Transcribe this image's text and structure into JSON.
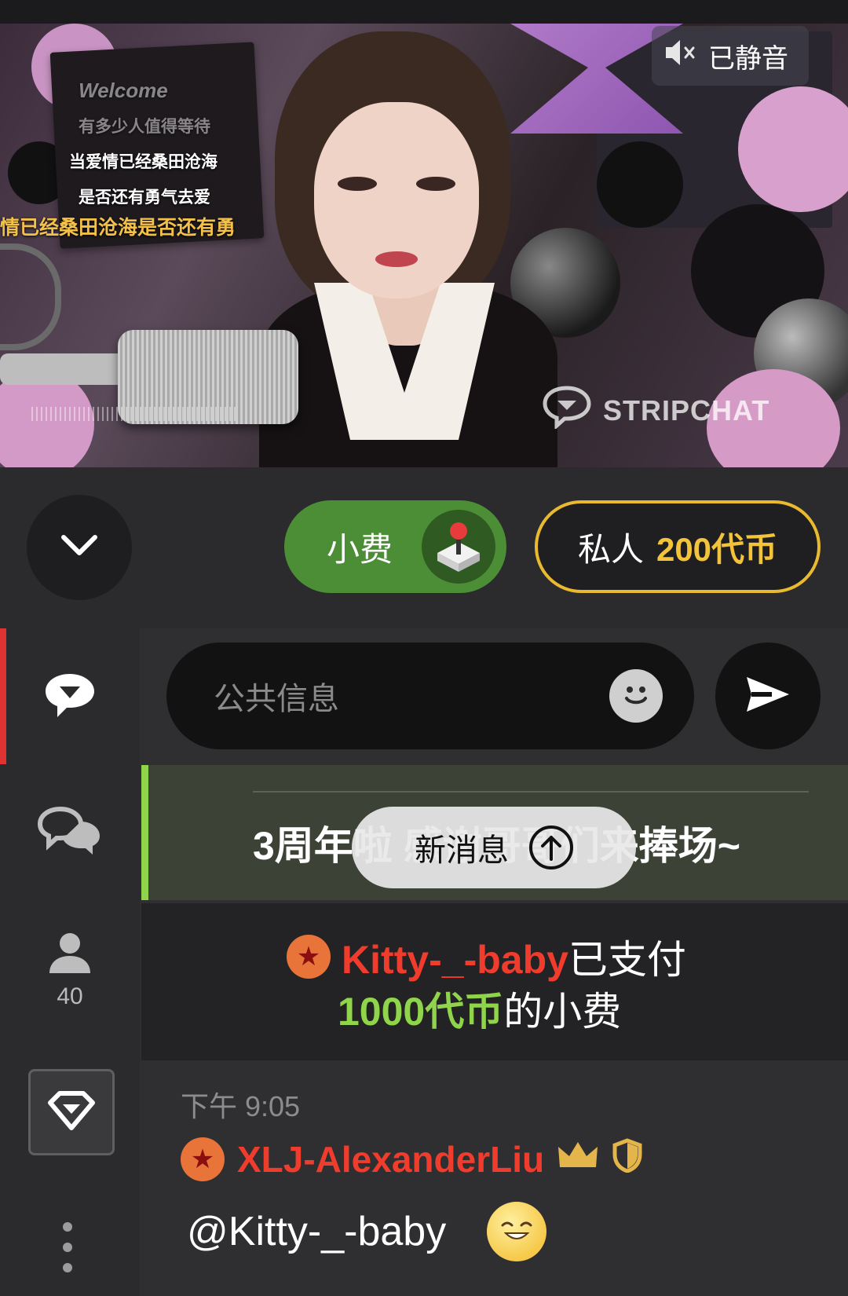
{
  "video": {
    "muted_label": "已静音",
    "watermark": "STRIPCHAT",
    "poster_lines": [
      "Welcome",
      "有多少人值得等待",
      "当爱情已经桑田沧海",
      "是否还有勇气去爱",
      "情已经桑田沧海是否还有勇"
    ]
  },
  "controls": {
    "tip_label": "小费",
    "private_label": "私人",
    "private_price": "200代币"
  },
  "sidebar": {
    "items": [
      {
        "icon": "public-chat-icon",
        "active": true
      },
      {
        "icon": "private-chats-icon",
        "active": false
      },
      {
        "icon": "users-icon",
        "count": "40",
        "active": false
      },
      {
        "icon": "diamond-icon",
        "active": false
      },
      {
        "icon": "more-vertical-icon",
        "active": false
      }
    ]
  },
  "chat": {
    "input_placeholder": "公共信息",
    "announcement": "3周年啦 感谢哥哥们来捧场~",
    "new_messages_label": "新消息",
    "tip_notice": {
      "username": "Kitty-_-baby",
      "paid_text": "已支付",
      "amount": "1000代币",
      "suffix": "的小费"
    },
    "message": {
      "time": "下午 9:05",
      "author": "XLJ-AlexanderLiu",
      "text": "@Kitty-_-baby"
    }
  },
  "colors": {
    "tip_green": "#4c8e35",
    "private_gold": "#e9b930",
    "username_red": "#ef3c2d",
    "amount_green": "#8fd44a",
    "active_red": "#dd3333"
  }
}
